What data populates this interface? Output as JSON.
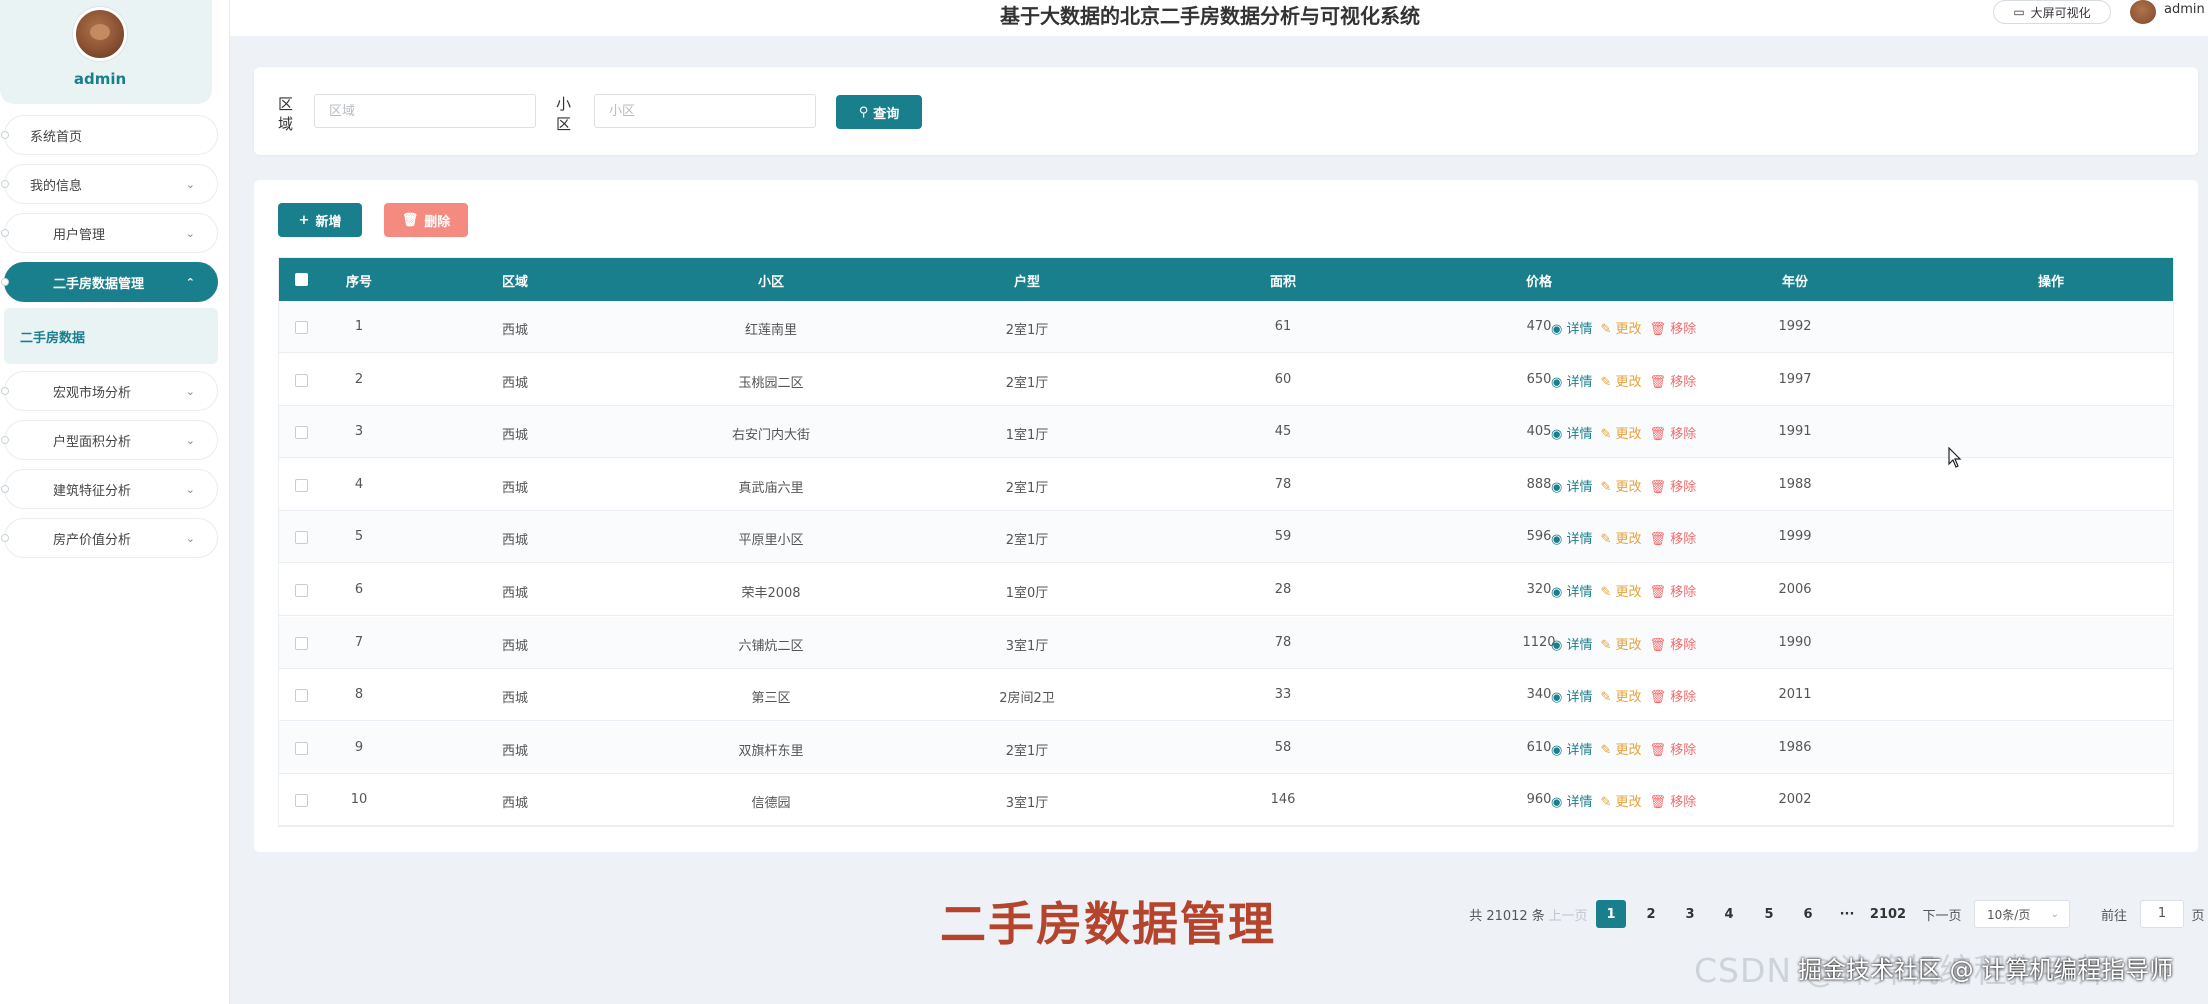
{
  "header": {
    "title": "基于大数据的北京二手房数据分析与可视化系统",
    "bigscreen_label": "大屏可视化",
    "user": "admin"
  },
  "sidebar": {
    "profile_name": "admin",
    "items": [
      {
        "label": "系统首页",
        "chevron": ""
      },
      {
        "label": "我的信息",
        "chevron": "⌄"
      },
      {
        "label": "用户管理",
        "chevron": "⌄"
      },
      {
        "label": "二手房数据管理",
        "chevron": "⌃"
      },
      {
        "label": "二手房数据"
      },
      {
        "label": "宏观市场分析",
        "chevron": "⌄"
      },
      {
        "label": "户型面积分析",
        "chevron": "⌄"
      },
      {
        "label": "建筑特征分析",
        "chevron": "⌄"
      },
      {
        "label": "房产价值分析",
        "chevron": "⌄"
      }
    ]
  },
  "search": {
    "district_label": "区域",
    "district_placeholder": "区域",
    "community_label": "小区",
    "community_placeholder": "小区",
    "search_button": "查询"
  },
  "toolbar": {
    "add_label": "新增",
    "delete_label": "删除"
  },
  "table": {
    "columns": [
      "序号",
      "区域",
      "小区",
      "户型",
      "面积",
      "价格",
      "年份",
      "操作"
    ],
    "rows": [
      [
        "1",
        "西城",
        "红莲南里",
        "2室1厅",
        "61",
        "470",
        "1992"
      ],
      [
        "2",
        "西城",
        "玉桃园二区",
        "2室1厅",
        "60",
        "650",
        "1997"
      ],
      [
        "3",
        "西城",
        "右安门内大街",
        "1室1厅",
        "45",
        "405",
        "1991"
      ],
      [
        "4",
        "西城",
        "真武庙六里",
        "2室1厅",
        "78",
        "888",
        "1988"
      ],
      [
        "5",
        "西城",
        "平原里小区",
        "2室1厅",
        "59",
        "596",
        "1999"
      ],
      [
        "6",
        "西城",
        "荣丰2008",
        "1室0厅",
        "28",
        "320",
        "2006"
      ],
      [
        "7",
        "西城",
        "六铺炕二区",
        "3室1厅",
        "78",
        "1120",
        "1990"
      ],
      [
        "8",
        "西城",
        "第三区",
        "2房间2卫",
        "33",
        "340",
        "2011"
      ],
      [
        "9",
        "西城",
        "双旗杆东里",
        "2室1厅",
        "58",
        "610",
        "1986"
      ],
      [
        "10",
        "西城",
        "信德园",
        "3室1厅",
        "146",
        "960",
        "2002"
      ]
    ],
    "ops": {
      "detail": "详情",
      "edit": "更改",
      "remove": "移除"
    }
  },
  "pagination": {
    "total": "共 21012 条",
    "prev": "上一页",
    "pages": [
      "1",
      "2",
      "3",
      "4",
      "5",
      "6"
    ],
    "ellipsis": "···",
    "last": "2102",
    "next": "下一页",
    "page_size": "10条/页",
    "goto_label": "前往",
    "goto_value": "1",
    "page_unit": "页"
  },
  "caption": "二手房数据管理",
  "watermark": {
    "text_a": "CSDN @计算机编程指导师",
    "text_b": "掘金技术社区 @ 计算机编程指导师"
  },
  "colors": {
    "primary": "#1a7f8c",
    "danger": "#f48a80",
    "caption": "#b5442c"
  }
}
